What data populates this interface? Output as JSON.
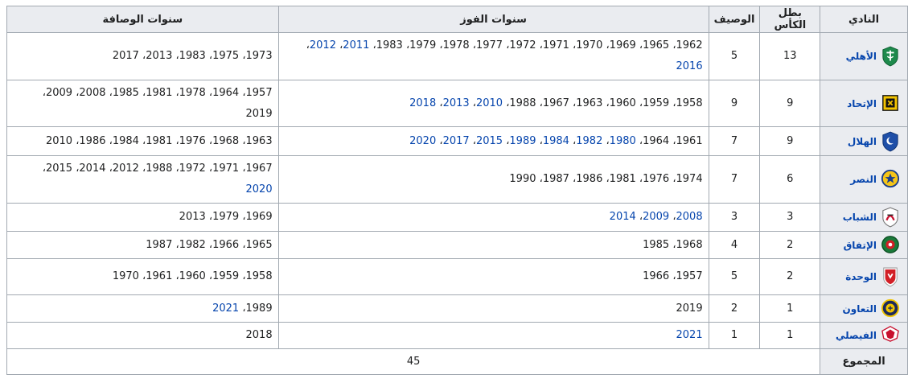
{
  "headers": {
    "club": "النادي",
    "champion": "بطل الكأس",
    "runner_up": "الوصيف",
    "win_years": "سنوات الفوز",
    "runner_up_years": "سنوات الوصافة"
  },
  "rows": [
    {
      "club": "الأهلي",
      "logo_icon": "al-ahli-logo-icon",
      "logo_color": "#1e8a4c",
      "champion": "13",
      "runner_up": "5",
      "win_years": [
        {
          "t": "1962",
          "link": false
        },
        {
          "t": "1965",
          "link": false
        },
        {
          "t": "1969",
          "link": false
        },
        {
          "t": "1970",
          "link": false
        },
        {
          "t": "1971",
          "link": false
        },
        {
          "t": "1972",
          "link": false
        },
        {
          "t": "1977",
          "link": false
        },
        {
          "t": "1978",
          "link": false
        },
        {
          "t": "1979",
          "link": false
        },
        {
          "t": "1983",
          "link": false
        },
        {
          "t": "2011",
          "link": true
        },
        {
          "t": "2012",
          "link": true
        },
        {
          "t": "2016",
          "link": true
        }
      ],
      "runner_up_years": [
        {
          "t": "1973",
          "link": false
        },
        {
          "t": "1975",
          "link": false
        },
        {
          "t": "1983",
          "link": false
        },
        {
          "t": "2013",
          "link": false
        },
        {
          "t": "2017",
          "link": false
        }
      ]
    },
    {
      "club": "الإتحاد",
      "logo_icon": "al-ittihad-logo-icon",
      "logo_color": "#f2c300",
      "champion": "9",
      "runner_up": "9",
      "win_years": [
        {
          "t": "1958",
          "link": false
        },
        {
          "t": "1959",
          "link": false
        },
        {
          "t": "1960",
          "link": false
        },
        {
          "t": "1963",
          "link": false
        },
        {
          "t": "1967",
          "link": false
        },
        {
          "t": "1988",
          "link": false
        },
        {
          "t": "2010",
          "link": true
        },
        {
          "t": "2013",
          "link": true
        },
        {
          "t": "2018",
          "link": true
        }
      ],
      "runner_up_years": [
        {
          "t": "1957",
          "link": false
        },
        {
          "t": "1964",
          "link": false
        },
        {
          "t": "1978",
          "link": false
        },
        {
          "t": "1981",
          "link": false
        },
        {
          "t": "1985",
          "link": false
        },
        {
          "t": "2008",
          "link": false
        },
        {
          "t": "2009",
          "link": false
        },
        {
          "t": "2019",
          "link": false
        }
      ]
    },
    {
      "club": "الهلال",
      "logo_icon": "al-hilal-logo-icon",
      "logo_color": "#1f4fa8",
      "champion": "9",
      "runner_up": "7",
      "win_years": [
        {
          "t": "1961",
          "link": false
        },
        {
          "t": "1964",
          "link": false
        },
        {
          "t": "1980",
          "link": true
        },
        {
          "t": "1982",
          "link": true
        },
        {
          "t": "1984",
          "link": true
        },
        {
          "t": "1989",
          "link": true
        },
        {
          "t": "2015",
          "link": true
        },
        {
          "t": "2017",
          "link": true
        },
        {
          "t": "2020",
          "link": true
        }
      ],
      "runner_up_years": [
        {
          "t": "1963",
          "link": false
        },
        {
          "t": "1968",
          "link": false
        },
        {
          "t": "1976",
          "link": false
        },
        {
          "t": "1981",
          "link": false
        },
        {
          "t": "1984",
          "link": false
        },
        {
          "t": "1986",
          "link": false
        },
        {
          "t": "2010",
          "link": false
        }
      ]
    },
    {
      "club": "النصر",
      "logo_icon": "al-nassr-logo-icon",
      "logo_color": "#f5c518",
      "champion": "6",
      "runner_up": "7",
      "win_years": [
        {
          "t": "1974",
          "link": false
        },
        {
          "t": "1976",
          "link": false
        },
        {
          "t": "1981",
          "link": false
        },
        {
          "t": "1986",
          "link": false
        },
        {
          "t": "1987",
          "link": false
        },
        {
          "t": "1990",
          "link": false
        }
      ],
      "runner_up_years": [
        {
          "t": "1967",
          "link": false
        },
        {
          "t": "1971",
          "link": false
        },
        {
          "t": "1972",
          "link": false
        },
        {
          "t": "1988",
          "link": false
        },
        {
          "t": "2012",
          "link": false
        },
        {
          "t": "2014",
          "link": false
        },
        {
          "t": "2015",
          "link": false
        },
        {
          "t": "2020",
          "link": true
        }
      ]
    },
    {
      "club": "الشباب",
      "logo_icon": "al-shabab-logo-icon",
      "logo_color": "#c8102e",
      "champion": "3",
      "runner_up": "3",
      "win_years": [
        {
          "t": "2008",
          "link": true
        },
        {
          "t": "2009",
          "link": true
        },
        {
          "t": "2014",
          "link": true
        }
      ],
      "runner_up_years": [
        {
          "t": "1969",
          "link": false
        },
        {
          "t": "1979",
          "link": false
        },
        {
          "t": "2013",
          "link": false
        }
      ]
    },
    {
      "club": "الإتفاق",
      "logo_icon": "al-ettifaq-logo-icon",
      "logo_color": "#1a7a3a",
      "champion": "2",
      "runner_up": "4",
      "win_years": [
        {
          "t": "1968",
          "link": false
        },
        {
          "t": "1985",
          "link": false
        }
      ],
      "runner_up_years": [
        {
          "t": "1965",
          "link": false
        },
        {
          "t": "1966",
          "link": false
        },
        {
          "t": "1982",
          "link": false
        },
        {
          "t": "1987",
          "link": false
        }
      ]
    },
    {
      "club": "الوحدة",
      "logo_icon": "al-wehda-logo-icon",
      "logo_color": "#d21f26",
      "champion": "2",
      "runner_up": "5",
      "win_years": [
        {
          "t": "1957",
          "link": false
        },
        {
          "t": "1966",
          "link": false
        }
      ],
      "runner_up_years": [
        {
          "t": "1958",
          "link": false
        },
        {
          "t": "1959",
          "link": false
        },
        {
          "t": "1960",
          "link": false
        },
        {
          "t": "1961",
          "link": false
        },
        {
          "t": "1970",
          "link": false
        }
      ]
    },
    {
      "club": "التعاون",
      "logo_icon": "al-taawoun-logo-icon",
      "logo_color": "#f0c400",
      "champion": "1",
      "runner_up": "2",
      "win_years": [
        {
          "t": "2019",
          "link": false
        }
      ],
      "runner_up_years": [
        {
          "t": "1989",
          "link": false
        },
        {
          "t": "2021",
          "link": true
        }
      ]
    },
    {
      "club": "الفيصلي",
      "logo_icon": "al-faisaly-logo-icon",
      "logo_color": "#c8102e",
      "champion": "1",
      "runner_up": "1",
      "win_years": [
        {
          "t": "2021",
          "link": true
        }
      ],
      "runner_up_years": [
        {
          "t": "2018",
          "link": false
        }
      ]
    }
  ],
  "total": {
    "label": "المجموع",
    "value": "45"
  },
  "colors": {
    "link": "#0645ad",
    "header_bg": "#eaecf0",
    "border": "#a2a9b1"
  }
}
